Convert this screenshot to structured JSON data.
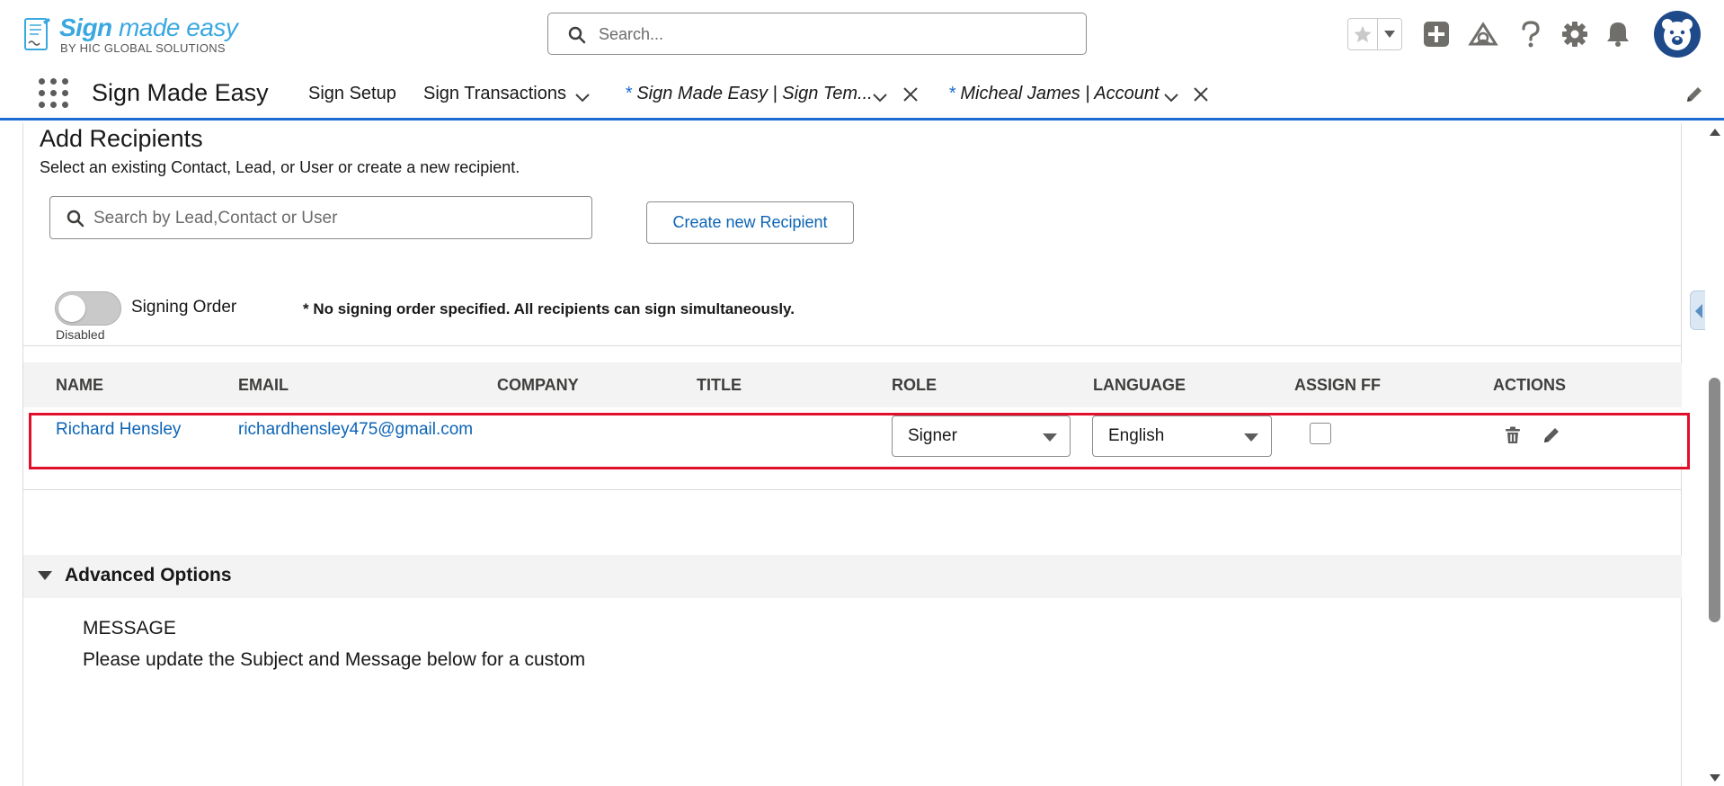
{
  "logo": {
    "main_bold": "Sign",
    "main_light": " made easy",
    "sub": "BY HIC GLOBAL SOLUTIONS"
  },
  "global_search": {
    "placeholder": "Search..."
  },
  "header_icons": [
    "favorites-star-icon",
    "chevron-down-icon",
    "plus-icon",
    "trailhead-icon",
    "help-icon",
    "gear-icon",
    "bell-icon",
    "avatar"
  ],
  "app_nav": {
    "app_name": "Sign Made Easy",
    "items": [
      {
        "label": "Sign Setup"
      },
      {
        "label": "Sign Transactions"
      }
    ],
    "workspace_tabs": [
      {
        "marker": "* ",
        "label": "Sign Made Easy | Sign Tem..."
      },
      {
        "marker": "* ",
        "label": "Micheal James | Account"
      }
    ]
  },
  "recipients": {
    "title": "Add Recipients",
    "subtitle": "Select an existing Contact, Lead, or User or create a new recipient.",
    "search_placeholder": "Search by Lead,Contact or User",
    "create_button": "Create new Recipient",
    "signing_order": {
      "label": "Signing Order",
      "state": "Disabled",
      "enabled": false,
      "note": "* No signing order specified. All recipients can sign simultaneously."
    },
    "columns": [
      "NAME",
      "EMAIL",
      "COMPANY",
      "TITLE",
      "ROLE",
      "LANGUAGE",
      "ASSIGN FF",
      "ACTIONS"
    ],
    "rows": [
      {
        "name": "Richard Hensley",
        "email": "richardhensley475@gmail.com",
        "company": "",
        "title": "",
        "role": "Signer",
        "language": "English",
        "assign_ff": false
      }
    ]
  },
  "advanced": {
    "title": "Advanced Options",
    "message_label": "MESSAGE",
    "message_text": "Please update the Subject and Message below for a custom"
  },
  "colors": {
    "brand_blue": "#1b6bd1",
    "link_blue": "#0b64b5",
    "highlight_red": "#e0102a",
    "logo_blue": "#3aa8e0"
  }
}
